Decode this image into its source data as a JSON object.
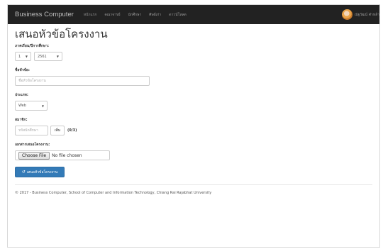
{
  "navbar": {
    "brand": "Business Computer",
    "links": [
      "หน้าแรก",
      "คณาจารย์",
      "นักศึกษา",
      "ศิษย์เก่า",
      "ดาวน์โหลด"
    ],
    "user_name": "ณัฐวัฒน์ คำหล้า"
  },
  "page": {
    "title": "เสนอหัวข้อโครงงาน"
  },
  "form": {
    "semester_label": "ภาคเรียน/ปีการศึกษา:",
    "semester_value": "1",
    "year_value": "2561",
    "topic_label": "ชื่อหัวข้อ:",
    "topic_placeholder": "ชื่อหัวข้อโครงงาน",
    "type_label": "ประเภท:",
    "type_value": "Web",
    "members_label": "สมาชิก:",
    "member_placeholder": "รหัสนักศึกษา",
    "add_button": "เพิ่ม",
    "member_count": "(0/3)",
    "document_label": "เอกสารเสนอโครงงาน:",
    "file_button": "Choose File",
    "file_status": "No file chosen",
    "submit_button": "เสนอหัวข้อโครงงาน"
  },
  "footer": {
    "text": "© 2017 - Business Computer, School of Computer and Information Technology, Chiang Rai Rajabhat University"
  },
  "colors": {
    "navbar": "#222222",
    "primary": "#337ab7"
  }
}
